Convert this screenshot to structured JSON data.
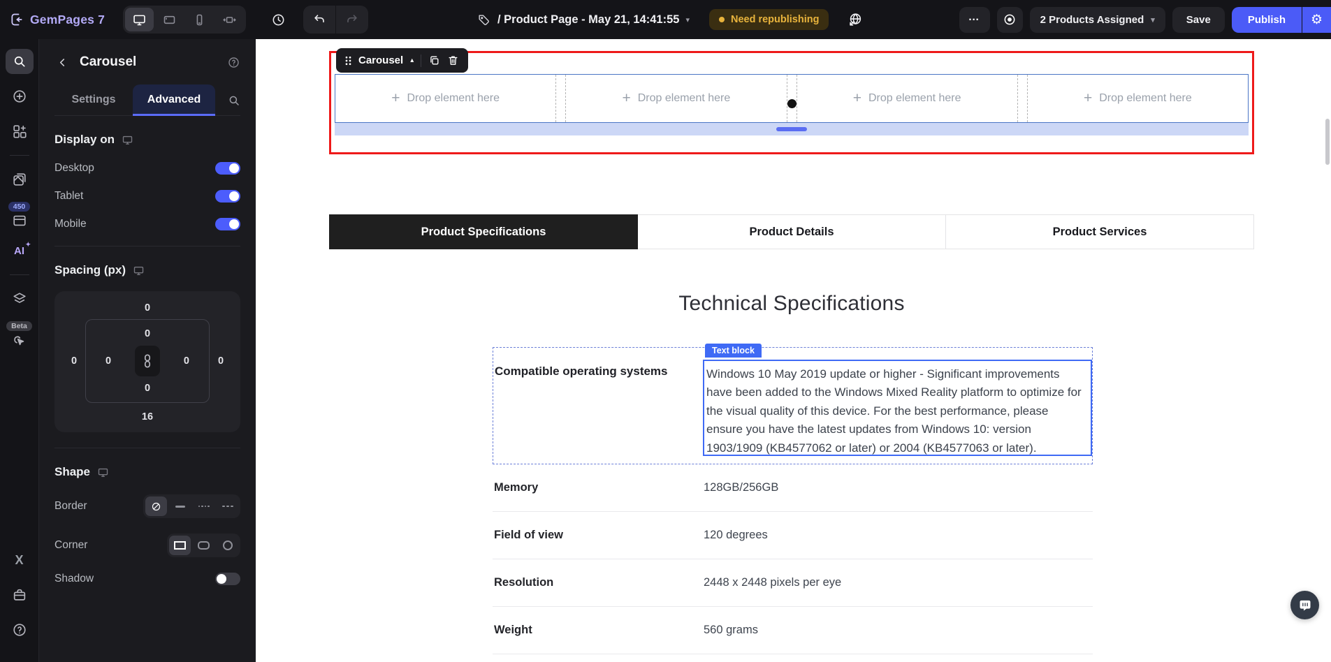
{
  "topbar": {
    "logo_text": "GemPages 7",
    "page_title": "/ Product Page - May 21, 14:41:55",
    "status_badge": "Need republishing",
    "products_assigned": "2 Products Assigned",
    "save": "Save",
    "publish": "Publish",
    "more_label": "...",
    "gear_glyph": "⚙"
  },
  "rail": {
    "count_badge": "450",
    "beta_badge": "Beta",
    "ai_label": "AI",
    "ai_spark": "✦",
    "x_label": "X"
  },
  "panel": {
    "title": "Carousel",
    "tab_settings": "Settings",
    "tab_advanced": "Advanced",
    "display_on": {
      "heading": "Display on",
      "desktop": "Desktop",
      "tablet": "Tablet",
      "mobile": "Mobile"
    },
    "spacing": {
      "heading": "Spacing (px)",
      "margin_top": "0",
      "margin_left": "0",
      "margin_right": "0",
      "margin_bottom": "16",
      "padding_top": "0",
      "padding_left": "0",
      "padding_right": "0",
      "padding_bottom": "0"
    },
    "shape": {
      "heading": "Shape",
      "border": "Border",
      "corner": "Corner",
      "shadow": "Shadow"
    }
  },
  "canvas": {
    "element_label": "Carousel",
    "drop_zone_label": "Drop element here",
    "content_tabs": [
      {
        "label": "Product Specifications",
        "active": true
      },
      {
        "label": "Product Details",
        "active": false
      },
      {
        "label": "Product Services",
        "active": false
      }
    ],
    "section_title": "Technical Specifications",
    "text_block_badge": "Text block",
    "spec_table": {
      "rows": [
        {
          "label": "Compatible operating systems",
          "value": "Windows 10 May 2019 update or higher - Significant improvements have been added to the Windows Mixed Reality platform to optimize for the visual quality of this device. For the best performance, please ensure you have the latest updates from Windows 10: version 1903/1909 (KB4577062 or later) or 2004 (KB4577063 or later)."
        },
        {
          "label": "Memory",
          "value": "128GB/256GB"
        },
        {
          "label": "Field of view",
          "value": "120 degrees"
        },
        {
          "label": "Resolution",
          "value": "2448 x 2448 pixels per eye"
        },
        {
          "label": "Weight",
          "value": "560 grams"
        }
      ]
    }
  },
  "colors": {
    "accent_blue": "#4c5dfc",
    "publish_blue": "#4b5bf7",
    "selection_red": "#ee1a1a",
    "builder_blue": "#3f6af5",
    "warning_amber": "#e8b33c",
    "carousel_strip": "#ccd7f6",
    "active_tab_bg": "#1f1f1f"
  }
}
